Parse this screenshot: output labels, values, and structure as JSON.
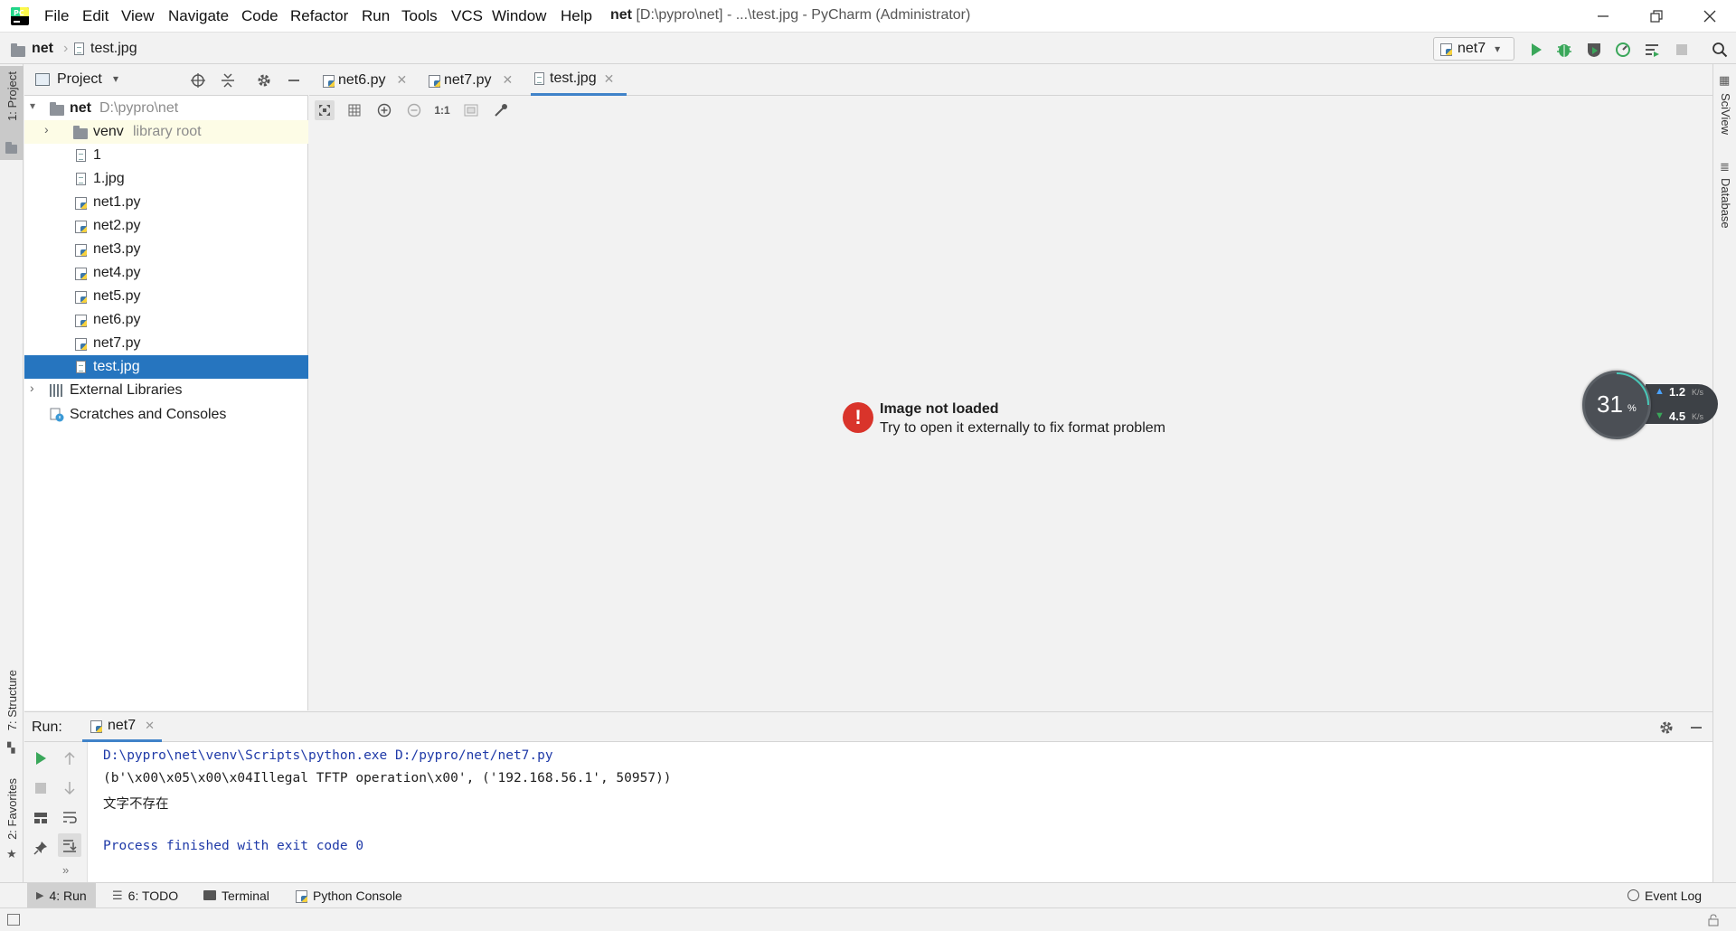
{
  "titlebar": {
    "menus": [
      "File",
      "Edit",
      "View",
      "Navigate",
      "Code",
      "Refactor",
      "Run",
      "Tools",
      "VCS",
      "Window",
      "Help"
    ],
    "project_name": "net",
    "title_rest": "[D:\\pypro\\net] - ...\\test.jpg - PyCharm (Administrator)"
  },
  "navbar": {
    "crumb_project": "net",
    "crumb_file": "test.jpg",
    "run_config": "net7"
  },
  "left_stripe": {
    "project": "1: Project",
    "structure": "7: Structure",
    "favorites": "2: Favorites"
  },
  "right_stripe": {
    "sciview": "SciView",
    "database": "Database"
  },
  "project_panel": {
    "title": "Project",
    "root_name": "net",
    "root_path": "D:\\pypro\\net",
    "venv_name": "venv",
    "venv_note": "library root",
    "files": [
      "1",
      "1.jpg",
      "net1.py",
      "net2.py",
      "net3.py",
      "net4.py",
      "net5.py",
      "net6.py",
      "net7.py",
      "test.jpg"
    ],
    "external_libraries": "External Libraries",
    "scratches": "Scratches and Consoles"
  },
  "editor": {
    "tabs": [
      "net6.py",
      "net7.py",
      "test.jpg"
    ],
    "active_tab": "test.jpg",
    "zoom_actual": "1:1",
    "error_title": "Image not loaded",
    "error_message": "Try to open it externally to fix format problem"
  },
  "speed_widget": {
    "percent": "31",
    "percent_unit": "%",
    "up": "1.2",
    "down": "4.5",
    "unit": "K/s"
  },
  "run_panel": {
    "label": "Run:",
    "tab": "net7",
    "lines": [
      "D:\\pypro\\net\\venv\\Scripts\\python.exe D:/pypro/net/net7.py",
      "(b'\\x00\\x05\\x00\\x04Illegal TFTP operation\\x00', ('192.168.56.1', 50957))",
      "文字不存在",
      "",
      "Process finished with exit code 0"
    ]
  },
  "bottom_bar": {
    "run": "4: Run",
    "todo": "6: TODO",
    "terminal": "Terminal",
    "python_console": "Python Console",
    "event_log": "Event Log"
  },
  "colors": {
    "accent": "#2675bf",
    "selection": "#2675bf",
    "run_green": "#3aa75a",
    "error_red": "#d9342b",
    "console_blue": "#1f3aa8"
  }
}
